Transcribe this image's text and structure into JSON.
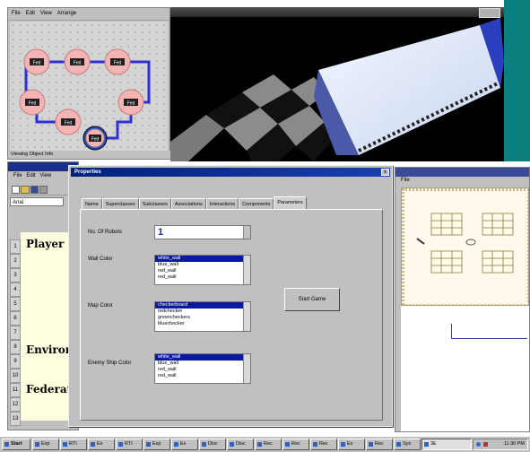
{
  "diagram_window": {
    "menu": [
      "File",
      "Edit",
      "View",
      "Arrange"
    ],
    "nodes": [
      "Fed",
      "Fed",
      "Fed",
      "Fed",
      "Fed",
      "Fed",
      "Fed"
    ],
    "status": "Viewing Object Info"
  },
  "spreadsheet": {
    "menu": [
      "File",
      "Edit",
      "View"
    ],
    "font": "Arial",
    "row_numbers": [
      "1",
      "2",
      "3",
      "4",
      "5",
      "6",
      "7",
      "8",
      "9",
      "10",
      "11",
      "12",
      "13"
    ],
    "cells": {
      "player": "Player",
      "environment": "Environm",
      "federation": "Federatio"
    }
  },
  "right_window": {
    "menu": "File"
  },
  "dialog": {
    "title": "Properties",
    "close": "x",
    "tabs": [
      "Name",
      "Superclasses",
      "Subclasses",
      "Associations",
      "Interactions",
      "Components",
      "Parameters"
    ],
    "active_tab": "Parameters",
    "fields": {
      "num_players_label": "No. Of Robots",
      "num_players_value": "1",
      "wall_color_label": "Wall Color",
      "wall_color_options": [
        "white_wall",
        "blue_wall",
        "red_wall",
        "red_wall"
      ],
      "map_color_label": "Map Color",
      "map_color_options": [
        "checkerboard",
        "redchecker",
        "greencheckers",
        "bluechecker"
      ],
      "enemy_color_label": "Enemy Ship Color",
      "enemy_color_options": [
        "white_wall",
        "blue_wall",
        "red_wall",
        "red_wall"
      ]
    },
    "start_button": "Start Game"
  },
  "taskbar": {
    "start": "Start",
    "buttons": [
      "Exp",
      "RTI",
      "Ex",
      "RTI",
      "Exp",
      "Ex",
      "Disc",
      "Disc",
      "Rec",
      "Rec",
      "Rec",
      "Ex",
      "Rec",
      "Sys",
      "3E"
    ],
    "active_index": 14,
    "clock": "11:30 PM"
  },
  "colors": {
    "dialog_title": "#00207a",
    "desktop_teal": "#0a7f7d",
    "list_selection": "#0a1aa0",
    "node_fill": "#f4b4b4",
    "connector": "#3030d0"
  }
}
